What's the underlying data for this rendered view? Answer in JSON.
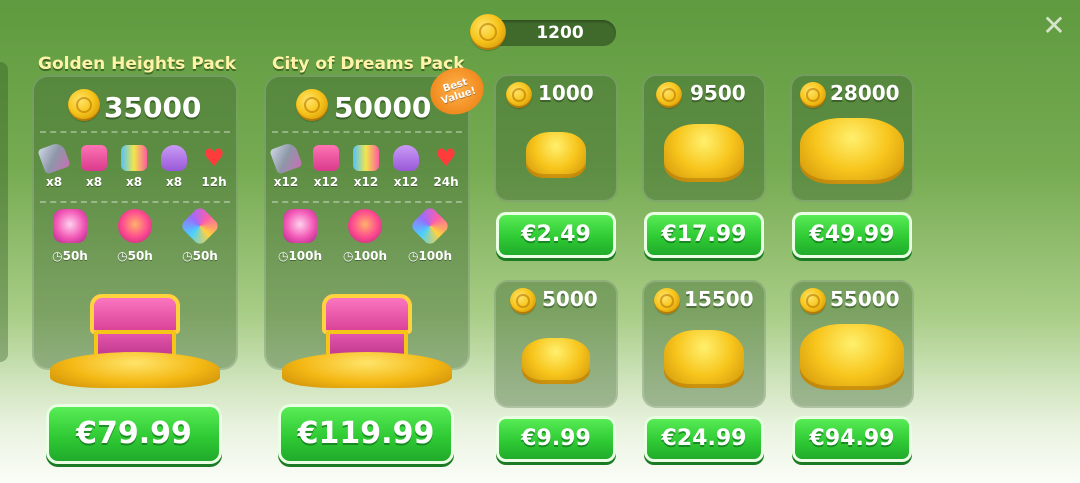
{
  "balance": {
    "amount": "1200",
    "icon": "coin-icon"
  },
  "close_icon": "close-icon",
  "packs": [
    {
      "title": "Golden Heights Pack",
      "coins": "35000",
      "items": [
        "x8",
        "x8",
        "x8",
        "x8",
        "12h"
      ],
      "boosters": [
        "50h",
        "50h",
        "50h"
      ],
      "price": "€79.99"
    },
    {
      "title": "City of Dreams Pack",
      "coins": "50000",
      "badge": "Best Value!",
      "items": [
        "x12",
        "x12",
        "x12",
        "x12",
        "24h"
      ],
      "boosters": [
        "100h",
        "100h",
        "100h"
      ],
      "price": "€119.99"
    }
  ],
  "offers": [
    {
      "coins": "1000",
      "price": "€2.49"
    },
    {
      "coins": "9500",
      "price": "€17.99"
    },
    {
      "coins": "28000",
      "price": "€49.99"
    },
    {
      "coins": "5000",
      "price": "€9.99"
    },
    {
      "coins": "15500",
      "price": "€24.99"
    },
    {
      "coins": "55000",
      "price": "€94.99"
    }
  ],
  "colors": {
    "buy_green": "#2fca34",
    "title_yellow": "#fff3a8",
    "badge_orange": "#f08a1e"
  }
}
